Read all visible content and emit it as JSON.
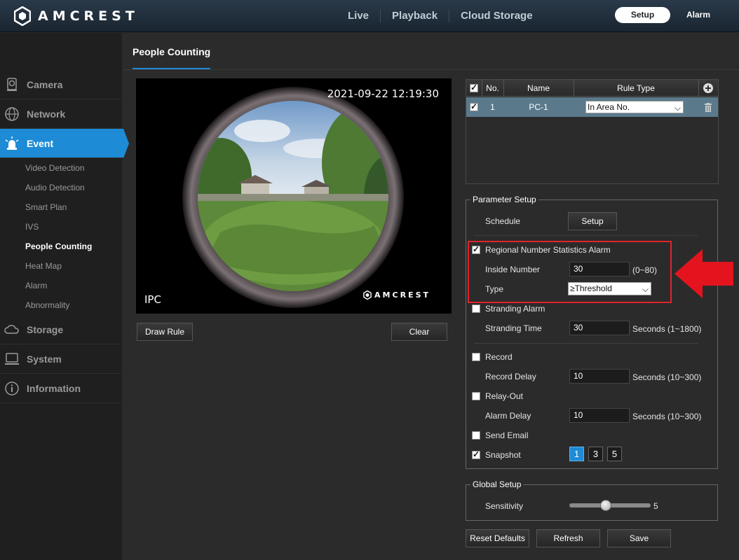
{
  "brand": {
    "name": "AMCREST"
  },
  "topnav": {
    "items": [
      "Live",
      "Playback",
      "Cloud Storage"
    ],
    "setup": "Setup",
    "alarm": "Alarm"
  },
  "sidebar": {
    "camera": "Camera",
    "network": "Network",
    "event": "Event",
    "sub": [
      "Video Detection",
      "Audio Detection",
      "Smart Plan",
      "IVS",
      "People Counting",
      "Heat Map",
      "Alarm",
      "Abnormality"
    ],
    "storage": "Storage",
    "system": "System",
    "information": "Information"
  },
  "page": {
    "tab": "People Counting"
  },
  "video": {
    "timestamp": "2021-09-22 12:19:30",
    "channel": "IPC",
    "watermark": "AMCREST"
  },
  "buttons": {
    "draw_rule": "Draw Rule",
    "clear": "Clear",
    "reset_defaults": "Reset Defaults",
    "refresh": "Refresh",
    "save": "Save"
  },
  "rule_table": {
    "headers": {
      "no": "No.",
      "name": "Name",
      "rule_type": "Rule Type"
    },
    "rows": [
      {
        "no": "1",
        "name": "PC-1",
        "rule_type": "In Area No."
      }
    ]
  },
  "param": {
    "legend": "Parameter Setup",
    "schedule": "Schedule",
    "schedule_btn": "Setup",
    "regional": "Regional Number Statistics Alarm",
    "inside_number": "Inside Number",
    "inside_value": "30",
    "inside_hint": "(0~80)",
    "type": "Type",
    "type_value": "≥Threshold",
    "stranding_alarm": "Stranding Alarm",
    "stranding_time": "Stranding Time",
    "stranding_value": "30",
    "stranding_hint": "Seconds (1~1800)",
    "record": "Record",
    "record_delay": "Record Delay",
    "record_value": "10",
    "record_hint": "Seconds (10~300)",
    "relay_out": "Relay-Out",
    "alarm_delay": "Alarm Delay",
    "alarm_value": "10",
    "alarm_hint": "Seconds (10~300)",
    "send_email": "Send Email",
    "snapshot": "Snapshot",
    "snapshot_options": [
      "1",
      "3",
      "5"
    ]
  },
  "global": {
    "legend": "Global Setup",
    "sensitivity": "Sensitivity",
    "sensitivity_value": "5"
  },
  "colors": {
    "accent": "#1e8bd6",
    "highlight": "#e0242c",
    "arrow": "#e3141d"
  }
}
